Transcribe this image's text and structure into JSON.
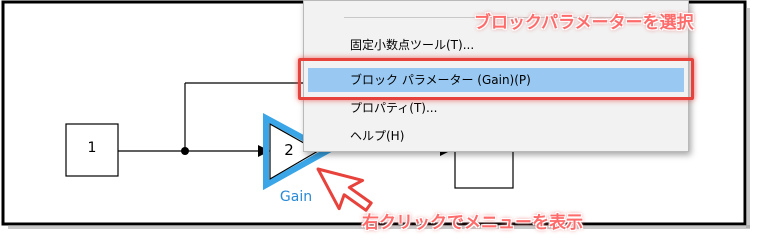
{
  "context_menu": {
    "items": [
      {
        "label": "固定小数点ツール(T)..."
      },
      {
        "label": "ブロック パラメーター (Gain)(P)",
        "selected": true
      },
      {
        "label": "プロパティ(T)..."
      },
      {
        "label": "ヘルプ(H)"
      }
    ]
  },
  "diagram": {
    "constant_block_value": "1",
    "gain_block_value": "2",
    "gain_block_name": "Gain"
  },
  "annotations": {
    "select_block_parameter": "ブロックパラメーターを選択",
    "right_click_menu": "右クリックでメニューを表示"
  },
  "colors": {
    "highlight": "#e8423c",
    "annotation_text": "#ff6a6a",
    "selected_item": "#99c9f2",
    "gain_outline": "#3aa6e8",
    "gain_label": "#2a8ad6"
  }
}
